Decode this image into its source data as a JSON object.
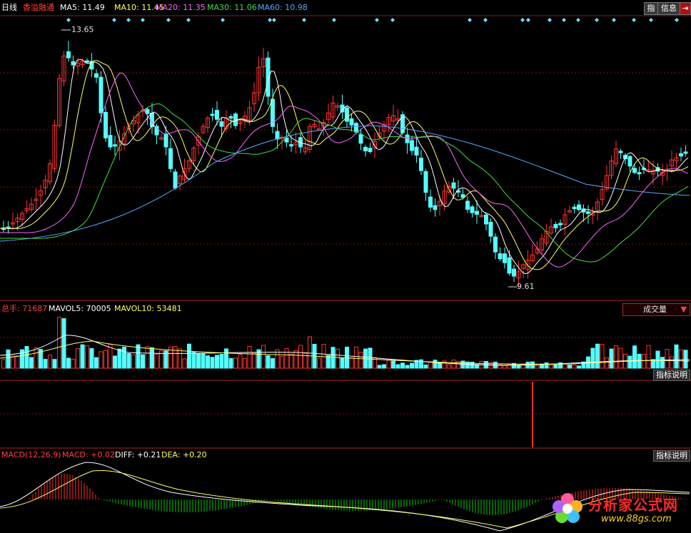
{
  "header": {
    "period": "日线",
    "stock_name": "香溢融通",
    "ma": [
      {
        "label": "MA5: 11.49",
        "color": "#ffffff"
      },
      {
        "label": "MA10: 11.45",
        "color": "#ffff66"
      },
      {
        "label": "MA20: 11.35",
        "color": "#ff66ff"
      },
      {
        "label": "MA30: 11.06",
        "color": "#44dd44"
      },
      {
        "label": "MA60: 10.98",
        "color": "#55aaff"
      }
    ],
    "buttons": {
      "zhi": "指",
      "info": "信息",
      "exit_icon": "exit-icon"
    }
  },
  "price_chart": {
    "high_label": "13.65",
    "low_label": "9.61",
    "colors": {
      "up": "#ff3232",
      "down": "#54ffff",
      "grid": "#7a1010"
    }
  },
  "volume": {
    "total_label": "总手: 71687",
    "mavol5_label": "MAVOL5: 70005",
    "mavol10_label": "MAVOL10: 53481",
    "selector_value": "成交量",
    "explain": "指标说明"
  },
  "macd": {
    "title": "MACD(12,26,9)",
    "macd_label": "MACD: +0.02",
    "diff_label": "DIFF: +0.21",
    "dea_label": "DEA: +0.20",
    "explain": "指标说明",
    "colors": {
      "pos": "#ff3232",
      "neg": "#00cc00",
      "diff": "#ffffff",
      "dea": "#ffff66"
    }
  },
  "logo": {
    "name": "分析家公式网",
    "url": "www.88gs.com"
  }
}
